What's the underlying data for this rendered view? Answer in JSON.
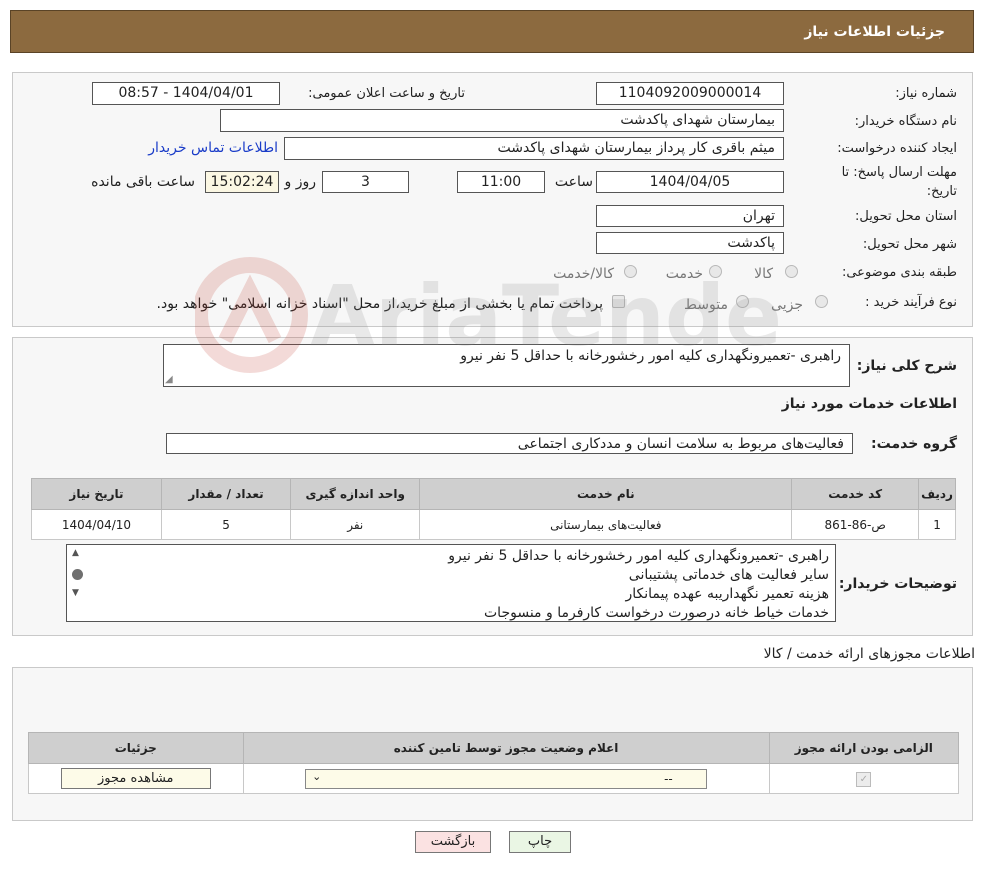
{
  "header": {
    "title": "جزئیات اطلاعات نیاز"
  },
  "form": {
    "need_number_label": "شماره نیاز:",
    "need_number": "1104092009000014",
    "announce_label": "تاریخ و ساعت اعلان عمومی:",
    "announce_value": "1404/04/01 - 08:57",
    "buyer_org_label": "نام دستگاه خریدار:",
    "buyer_org": "بیمارستان شهدای پاکدشت",
    "creator_label": "ایجاد کننده درخواست:",
    "creator": "میثم باقری کار پرداز بیمارستان شهدای پاکدشت",
    "contact_link": "اطلاعات تماس خریدار",
    "deadline_label_1": "مهلت ارسال پاسخ: تا",
    "deadline_label_2": "تاریخ:",
    "deadline_date": "1404/04/05",
    "time_label": "ساعت",
    "deadline_time": "11:00",
    "days_value": "3",
    "days_label": "روز و",
    "remaining_time": "15:02:24",
    "remaining_label": "ساعت باقی مانده",
    "province_label": "استان محل تحویل:",
    "province": "تهران",
    "city_label": "شهر محل تحویل:",
    "city": "پاکدشت",
    "category_label": "طبقه بندی موضوعی:",
    "category_options": [
      "کالا",
      "خدمت",
      "کالا/خدمت"
    ],
    "process_label": "نوع فرآیند خرید :",
    "process_options": [
      "جزیی",
      "متوسط"
    ],
    "process_note": "پرداخت تمام یا بخشی از مبلغ خرید،از محل \"اسناد خزانه اسلامی\" خواهد بود."
  },
  "summary": {
    "label": "شرح کلی نیاز:",
    "text": "راهبری -تعمیرونگهداری کلیه امور رخشورخانه با حداقل 5 نفر نیرو"
  },
  "services": {
    "section_title": "اطلاعات خدمات مورد نیاز",
    "group_label": "گروه خدمت:",
    "group_value": "فعالیت‌های مربوط به سلامت انسان و مددکاری اجتماعی",
    "table_headers": [
      "ردیف",
      "کد خدمت",
      "نام خدمت",
      "واحد اندازه گیری",
      "تعداد / مقدار",
      "تاریخ نیاز"
    ],
    "rows": [
      [
        "1",
        "ص-86-861",
        "فعالیت‌های بیمارستانی",
        "نفر",
        "5",
        "1404/04/10"
      ]
    ]
  },
  "buyer_notes": {
    "label": "توضیحات خریدار:",
    "lines": [
      "راهبری -تعمیرونگهداری کلیه امور رخشورخانه با حداقل 5 نفر نیرو",
      "سایر فعالیت های خدماتی پشتیبانی",
      "هزینه تعمیر نگهداریبه عهده پیمانکار",
      "خدمات خیاط خانه درصورت درخواست کارفرما و منسوجات"
    ]
  },
  "permits": {
    "section_title": "اطلاعات مجوزهای ارائه خدمت / کالا",
    "headers": [
      "الزامی بودن ارائه مجوز",
      "اعلام وضعیت مجوز توسط تامین کننده",
      "جزئیات"
    ],
    "select_value": "--",
    "view_button": "مشاهده مجوز"
  },
  "footer": {
    "print_button": "چاپ",
    "back_button": "بازگشت"
  },
  "watermark": {
    "text": "AriaTender.net"
  }
}
